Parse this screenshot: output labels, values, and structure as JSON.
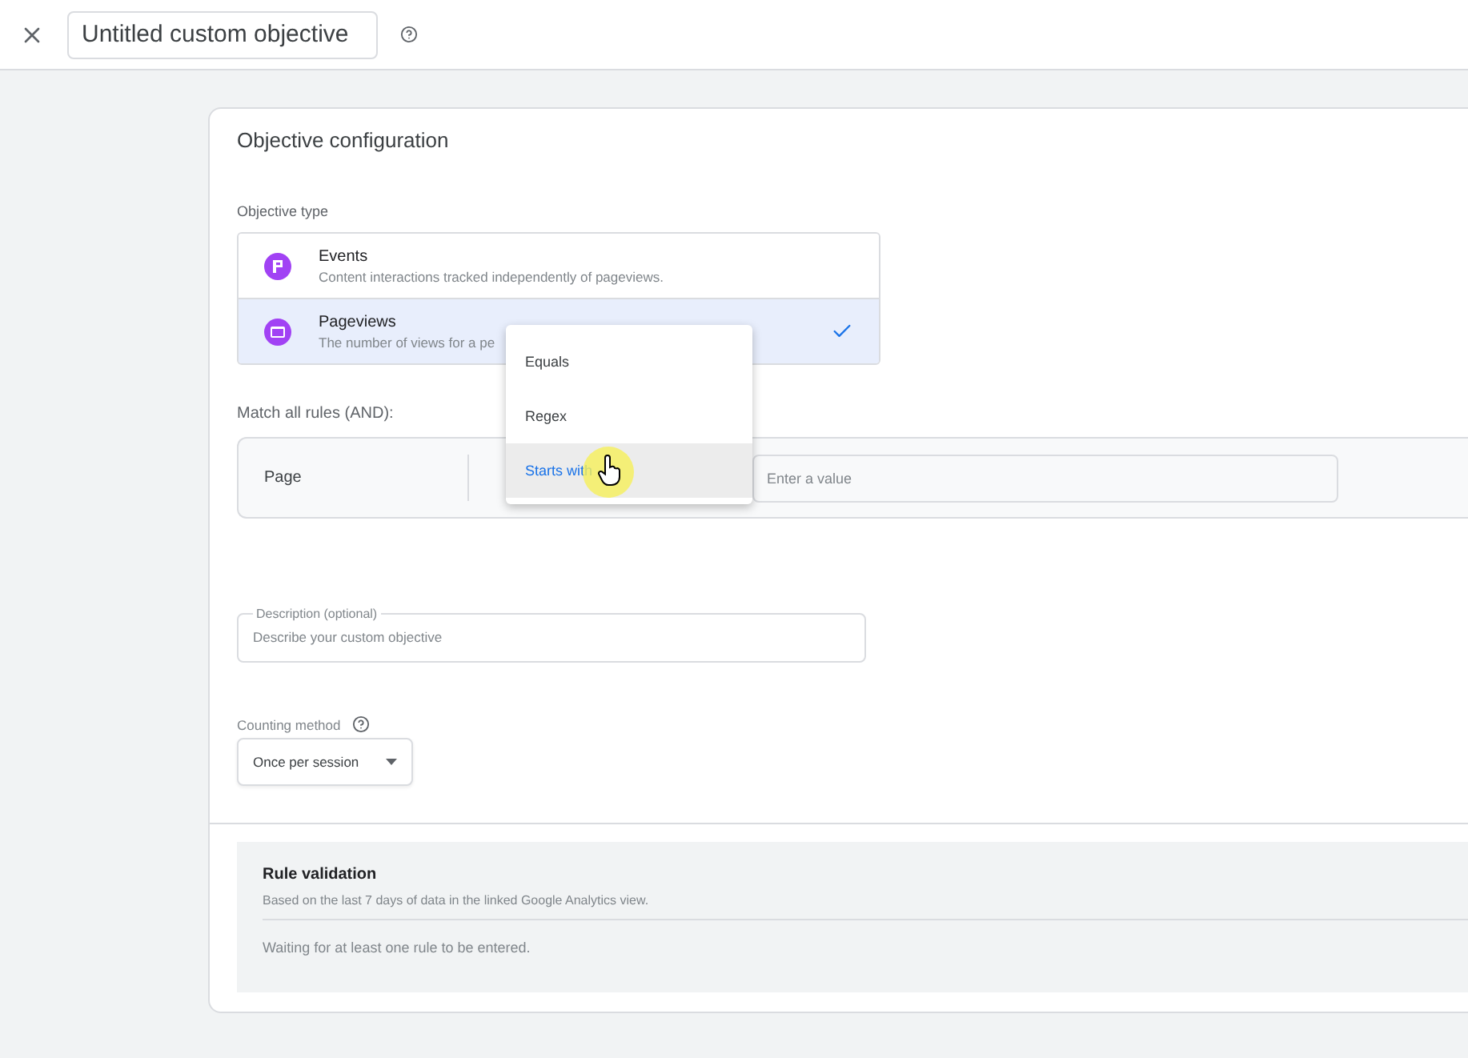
{
  "header": {
    "title": "Untitled custom objective"
  },
  "card": {
    "title": "Objective configuration",
    "type_label": "Objective type",
    "options": [
      {
        "kind": "events",
        "title": "Events",
        "description": "Content interactions tracked independently of pageviews.",
        "selected": false
      },
      {
        "kind": "pageviews",
        "title": "Pageviews",
        "description": "The number of views for a pe",
        "selected": true
      }
    ],
    "match_label": "Match all rules (AND):",
    "rule": {
      "field": "Page",
      "placeholder": "Enter a value"
    },
    "menu": [
      {
        "label": "Equals",
        "selected": false
      },
      {
        "label": "Regex",
        "selected": false
      },
      {
        "label": "Starts with",
        "selected": true
      }
    ],
    "description": {
      "label": "Description (optional)",
      "placeholder": "Describe your custom objective"
    },
    "counting": {
      "label": "Counting method",
      "value": "Once per session"
    },
    "validation": {
      "title": "Rule validation",
      "subtitle": "Based on the last 7 days of data in the linked Google Analytics view.",
      "status": "Waiting for at least one rule to be entered."
    }
  }
}
